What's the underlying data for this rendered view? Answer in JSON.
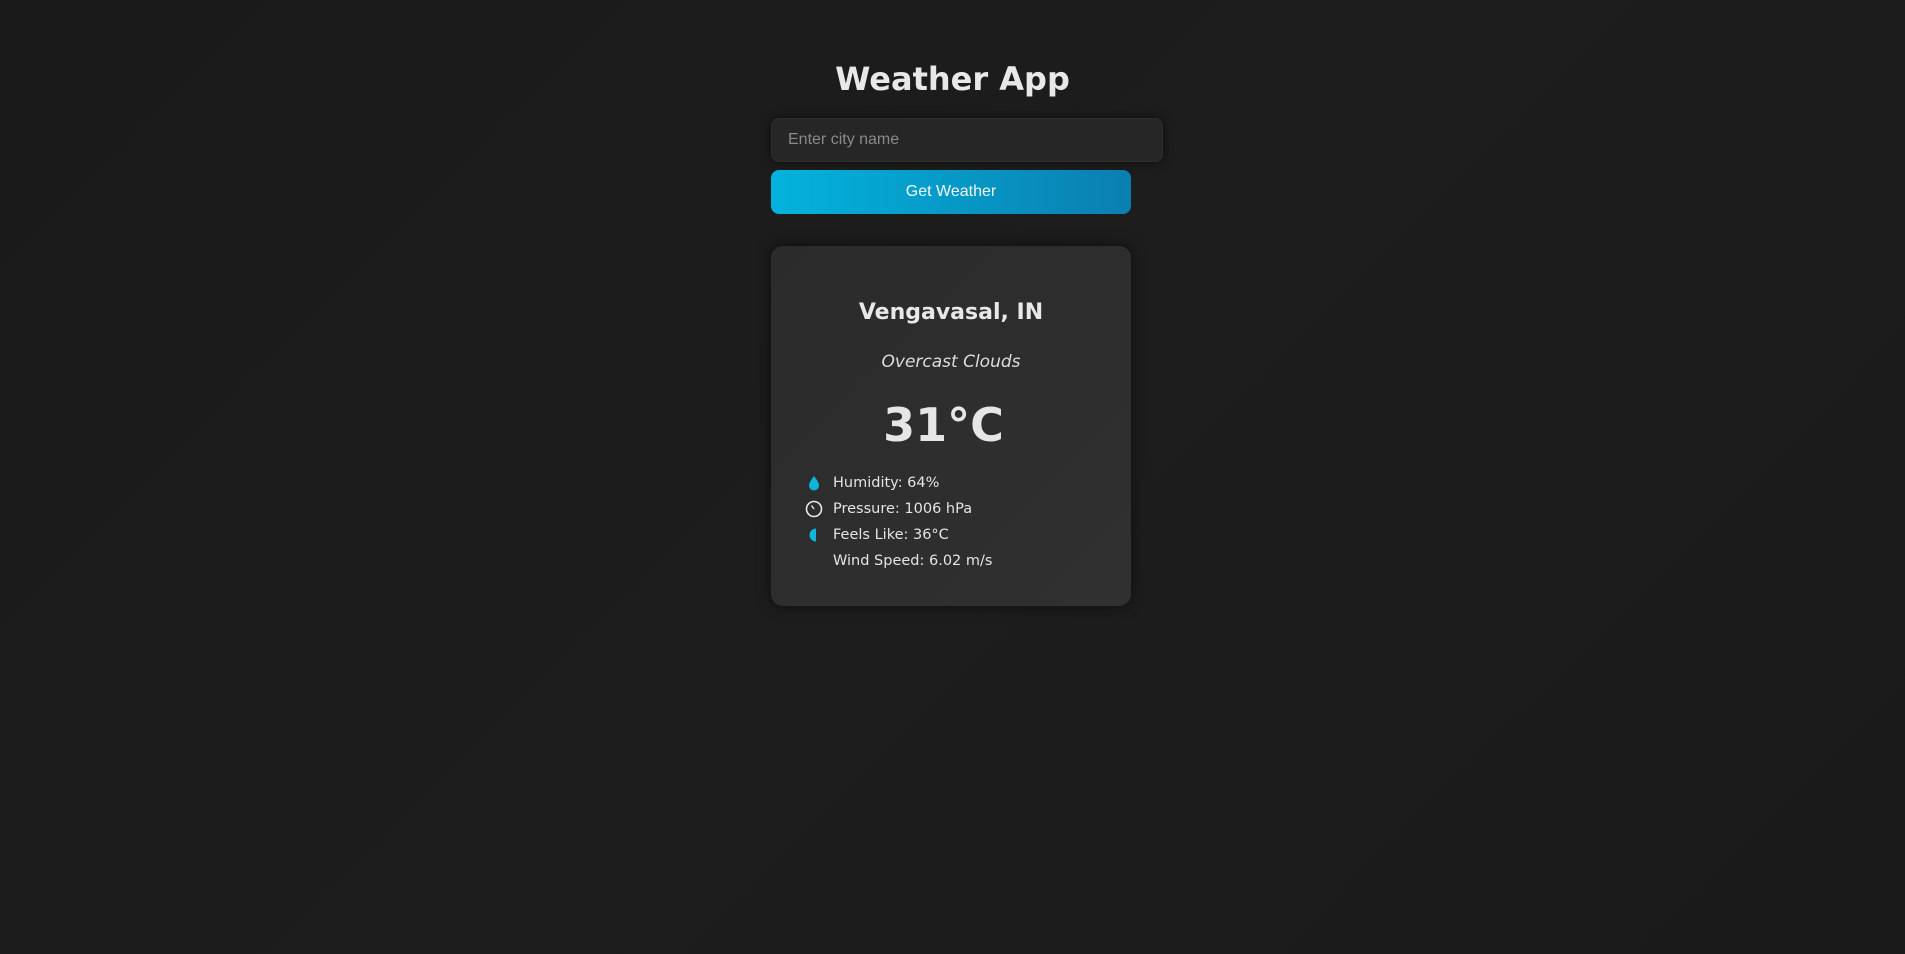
{
  "app": {
    "title": "Weather App"
  },
  "search": {
    "placeholder": "Enter city name",
    "value": "",
    "button_label": "Get Weather"
  },
  "weather": {
    "location": "Vengavasal, IN",
    "description": "Overcast Clouds",
    "temperature": "31°C",
    "details": [
      {
        "icon": "humidity-drop-icon",
        "text": "Humidity: 64%"
      },
      {
        "icon": "pressure-gauge-icon",
        "text": "Pressure: 1006 hPa"
      },
      {
        "icon": "feels-like-half-circle-icon",
        "text": "Feels Like: 36°C"
      },
      {
        "icon": "",
        "text": "Wind Speed: 6.02 m/s"
      }
    ]
  },
  "colors": {
    "background": "#1b1b1b",
    "card": "#2e2e2e",
    "accent": "#03b3dd",
    "accent_dark": "#0a7fb0",
    "text": "#e6e6e6"
  }
}
